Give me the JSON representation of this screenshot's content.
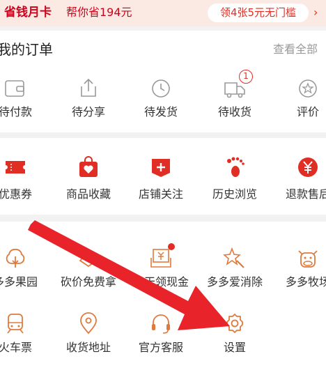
{
  "banner": {
    "title": "省钱月卡",
    "subtitle": "帮你省194元",
    "coupon": "领4张5元无门槛",
    "arrow": "›"
  },
  "orders": {
    "title": "我的订单",
    "view_all": "查看全部",
    "items": [
      {
        "label": "待付款",
        "icon": "wallet-icon"
      },
      {
        "label": "待分享",
        "icon": "share-icon"
      },
      {
        "label": "待发货",
        "icon": "clock-icon"
      },
      {
        "label": "待收货",
        "icon": "truck-icon",
        "badge": "1"
      },
      {
        "label": "评价",
        "icon": "star-bubble-icon"
      }
    ]
  },
  "shortcuts": {
    "items": [
      {
        "label": "优惠券",
        "icon": "ticket-icon"
      },
      {
        "label": "商品收藏",
        "icon": "heart-bag-icon"
      },
      {
        "label": "店铺关注",
        "icon": "store-plus-icon"
      },
      {
        "label": "历史浏览",
        "icon": "footprint-icon"
      },
      {
        "label": "退款售后",
        "icon": "yen-refund-icon"
      }
    ]
  },
  "services": {
    "row1": [
      {
        "label": "多多果园",
        "icon": "tree-icon"
      },
      {
        "label": "砍价免费拿",
        "icon": "bargain-icon"
      },
      {
        "label": "天天领现金",
        "icon": "cash-envelope-icon",
        "dot": true
      },
      {
        "label": "多多爱消除",
        "icon": "magic-star-icon"
      },
      {
        "label": "多多牧场",
        "icon": "cow-icon"
      }
    ],
    "row2": [
      {
        "label": "火车票",
        "icon": "train-icon"
      },
      {
        "label": "收货地址",
        "icon": "location-icon"
      },
      {
        "label": "官方客服",
        "icon": "headset-icon"
      },
      {
        "label": "设置",
        "icon": "gear-icon"
      }
    ]
  },
  "colors": {
    "accent": "#e02e24",
    "banner_bg": "#fbe9e3",
    "arrow": "#e8232a",
    "outline_icon": "#999999",
    "service_icon": "#e07a3c"
  }
}
